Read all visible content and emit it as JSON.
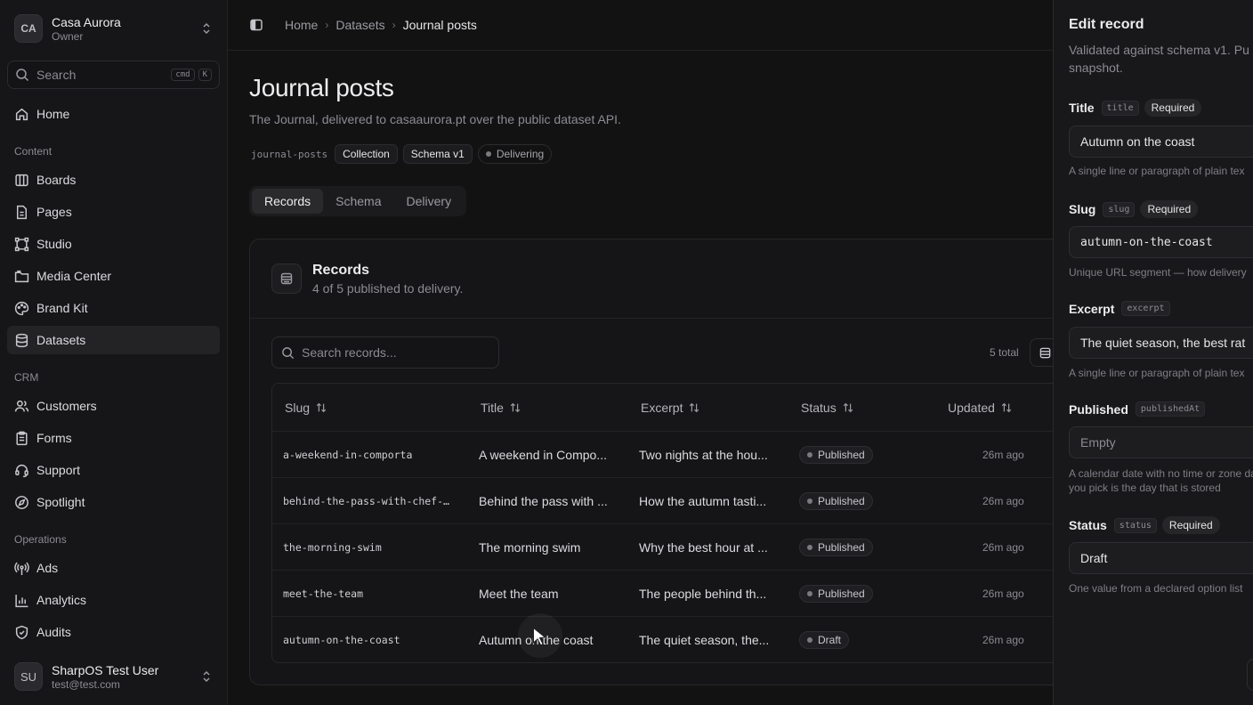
{
  "workspace": {
    "initials": "CA",
    "name": "Casa Aurora",
    "role": "Owner"
  },
  "sidebar": {
    "search_label": "Search",
    "shortcut": [
      "cmd",
      "K"
    ],
    "home": "Home",
    "sections": [
      {
        "title": "Content",
        "items": [
          "Boards",
          "Pages",
          "Studio",
          "Media Center",
          "Brand Kit",
          "Datasets"
        ]
      },
      {
        "title": "CRM",
        "items": [
          "Customers",
          "Forms",
          "Support",
          "Spotlight"
        ]
      },
      {
        "title": "Operations",
        "items": [
          "Ads",
          "Analytics",
          "Audits"
        ]
      }
    ],
    "active_item": "Datasets",
    "icons": {
      "home": "home-icon",
      "boards": "columns-icon",
      "pages": "file-icon",
      "studio": "nodes-icon",
      "media": "folder-icon",
      "brand": "palette-icon",
      "datasets": "database-icon",
      "customers": "users-icon",
      "forms": "clipboard-icon",
      "support": "headset-icon",
      "spotlight": "compass-icon",
      "ads": "broadcast-icon",
      "analytics": "bar-chart-icon",
      "audits": "shield-icon"
    }
  },
  "user": {
    "initials": "SU",
    "name": "SharpOS Test User",
    "email": "test@test.com"
  },
  "breadcrumb": [
    "Home",
    "Datasets",
    "Journal posts"
  ],
  "page": {
    "title": "Journal posts",
    "subtitle": "The Journal, delivered to casaaurora.pt over the public dataset API.",
    "badges": {
      "slug": "journal-posts",
      "type": "Collection",
      "schema": "Schema v1",
      "delivery": "Delivering"
    },
    "tabs": [
      "Records",
      "Schema",
      "Delivery"
    ],
    "active_tab": "Records"
  },
  "records": {
    "title": "Records",
    "subtitle": "4 of 5 published to delivery.",
    "search_placeholder": "Search records...",
    "total": "5 total",
    "columns": [
      "Slug",
      "Title",
      "Excerpt",
      "Status",
      "Updated"
    ],
    "rows": [
      {
        "slug": "a-weekend-in-comporta",
        "title": "A weekend in Compo...",
        "excerpt": "Two nights at the hou...",
        "status": "Published",
        "updated": "26m ago"
      },
      {
        "slug": "behind-the-pass-with-chef-…",
        "title": "Behind the pass with ...",
        "excerpt": "How the autumn tasti...",
        "status": "Published",
        "updated": "26m ago"
      },
      {
        "slug": "the-morning-swim",
        "title": "The morning swim",
        "excerpt": "Why the best hour at ...",
        "status": "Published",
        "updated": "26m ago"
      },
      {
        "slug": "meet-the-team",
        "title": "Meet the team",
        "excerpt": "The people behind th...",
        "status": "Published",
        "updated": "26m ago"
      },
      {
        "slug": "autumn-on-the-coast",
        "title": "Autumn on the coast",
        "excerpt": "The quiet season, the...",
        "status": "Draft",
        "updated": "26m ago"
      }
    ]
  },
  "panel": {
    "title": "Edit record",
    "subtitle": "Validated against schema v1. Pu snapshot.",
    "required_label": "Required",
    "fields": [
      {
        "label": "Title",
        "key": "title",
        "required": true,
        "value": "Autumn on the coast",
        "help": "A single line or paragraph of plain tex"
      },
      {
        "label": "Slug",
        "key": "slug",
        "required": true,
        "value": "autumn-on-the-coast",
        "help": "Unique URL segment — how delivery"
      },
      {
        "label": "Excerpt",
        "key": "excerpt",
        "required": false,
        "value": "The quiet season, the best rat",
        "help": "A single line or paragraph of plain tex"
      },
      {
        "label": "Published",
        "key": "publishedAt",
        "required": false,
        "placeholder": "Empty",
        "help": "A calendar date with no time or zone day you pick is the day that is stored"
      },
      {
        "label": "Status",
        "key": "status",
        "required": true,
        "value": "Draft",
        "help": "One value from a declared option list"
      }
    ]
  }
}
